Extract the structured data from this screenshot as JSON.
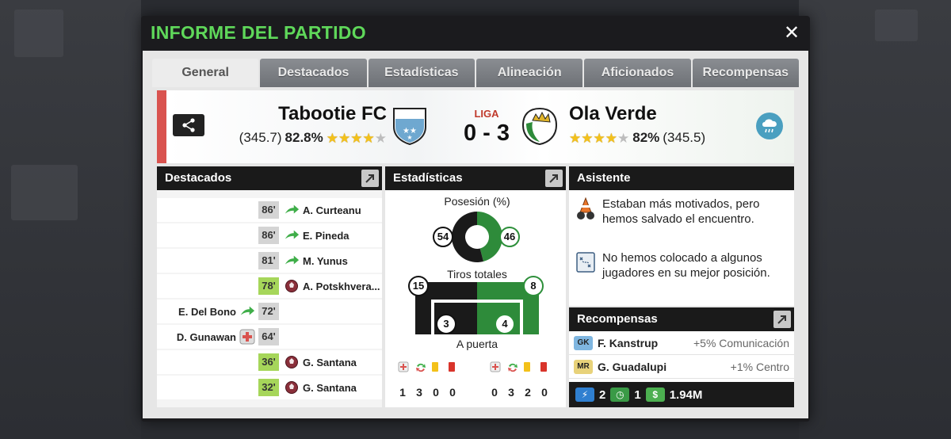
{
  "modal": {
    "title": "INFORME DEL PARTIDO",
    "close_symbol": "✕"
  },
  "tabs": [
    {
      "label": "General",
      "active": true
    },
    {
      "label": "Destacados",
      "active": false
    },
    {
      "label": "Estadísticas",
      "active": false
    },
    {
      "label": "Alineación",
      "active": false
    },
    {
      "label": "Aficionados",
      "active": false
    },
    {
      "label": "Recompensas",
      "active": false
    }
  ],
  "match": {
    "competition": "LIGA",
    "score": "0 - 3",
    "home": {
      "name": "Tabootie FC",
      "strength": "(345.7)",
      "pct": "82.8%",
      "stars_filled": 4,
      "stars_total": 5
    },
    "away": {
      "name": "Ola Verde",
      "strength": "(345.5)",
      "pct": "82%",
      "stars_filled": 4,
      "stars_total": 5
    },
    "weather_icon": "rain-cloud-icon"
  },
  "highlights": {
    "title": "Destacados",
    "rows": [
      {
        "minute": "86'",
        "side": "away",
        "event": "substitution-in-icon",
        "player": "A. Curteanu",
        "green": false
      },
      {
        "minute": "86'",
        "side": "away",
        "event": "substitution-in-icon",
        "player": "E. Pineda",
        "green": false
      },
      {
        "minute": "81'",
        "side": "away",
        "event": "substitution-in-icon",
        "player": "M. Yunus",
        "green": false
      },
      {
        "minute": "78'",
        "side": "away",
        "event": "goal-ball-icon",
        "player": "A. Potskhvera...",
        "green": true
      },
      {
        "minute": "72'",
        "side": "home",
        "event": "substitution-in-icon",
        "player": "E. Del Bono",
        "green": false
      },
      {
        "minute": "64'",
        "side": "home",
        "event": "injury-icon",
        "player": "D. Gunawan",
        "green": false
      },
      {
        "minute": "36'",
        "side": "away",
        "event": "goal-ball-icon",
        "player": "G. Santana",
        "green": true
      },
      {
        "minute": "32'",
        "side": "away",
        "event": "goal-ball-icon",
        "player": "G. Santana",
        "green": true
      }
    ]
  },
  "stats": {
    "title": "Estadísticas",
    "possession_label": "Posesión (%)",
    "possession_home": 54,
    "possession_away": 46,
    "shots_label": "Tiros totales",
    "shots_home": "15",
    "shots_away": "8",
    "on_target_label": "A puerta",
    "on_target_home": "3",
    "on_target_away": "4",
    "home_cards": {
      "injuries": "1",
      "subs": "3",
      "yellow": "0",
      "red": "0"
    },
    "away_cards": {
      "injuries": "0",
      "subs": "3",
      "yellow": "2",
      "red": "0"
    },
    "colors": {
      "home": "#1a1a1a",
      "away": "#2e8b3a"
    }
  },
  "assistant": {
    "title": "Asistente",
    "messages": [
      {
        "icon": "motivation-cone-icon",
        "text": "Estaban más motivados, pero hemos salvado el encuentro."
      },
      {
        "icon": "tactics-board-icon",
        "text": "No hemos colocado a algunos jugadores en su mejor posición."
      }
    ]
  },
  "rewards": {
    "title": "Recompensas",
    "rows": [
      {
        "badge": "GK",
        "player": "F. Kanstrup",
        "bonus": "+5% Comunicación"
      },
      {
        "badge": "MR",
        "player": "G. Guadalupi",
        "bonus": "+1% Centro"
      }
    ],
    "currency": {
      "energy": "2",
      "time": "1",
      "money": "1.94M"
    }
  }
}
